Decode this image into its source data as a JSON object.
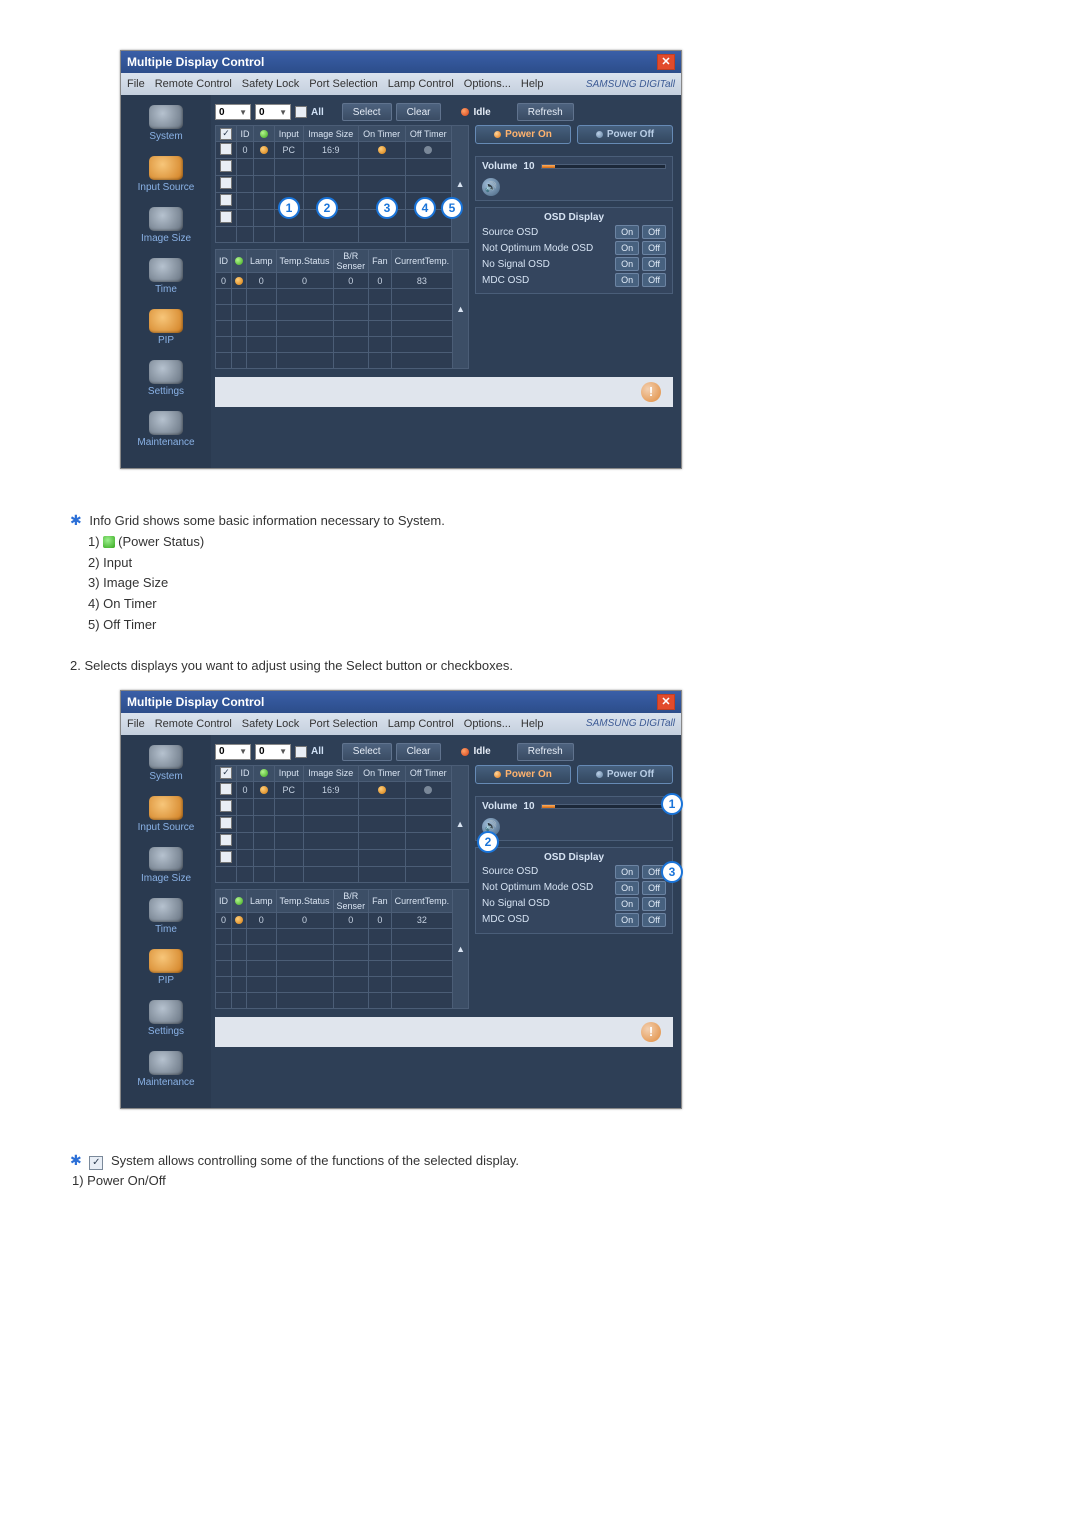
{
  "window": {
    "title": "Multiple Display Control",
    "brand": "SAMSUNG DIGITall"
  },
  "menu": [
    "File",
    "Remote Control",
    "Safety Lock",
    "Port Selection",
    "Lamp Control",
    "Options...",
    "Help"
  ],
  "sidebar": [
    {
      "label": "System"
    },
    {
      "label": "Input Source"
    },
    {
      "label": "Image Size"
    },
    {
      "label": "Time"
    },
    {
      "label": "PIP"
    },
    {
      "label": "Settings"
    },
    {
      "label": "Maintenance"
    }
  ],
  "toolbar": {
    "spin1": "0",
    "spin2": "0",
    "all": "All",
    "select": "Select",
    "clear": "Clear",
    "idle": "Idle",
    "refresh": "Refresh"
  },
  "grid1": {
    "headers": [
      "",
      "ID",
      "",
      "Input",
      "Image Size",
      "On Timer",
      "Off Timer"
    ],
    "row": {
      "id": "0",
      "input": "PC",
      "size": "16:9",
      "temp": "83"
    }
  },
  "grid2": {
    "headers": [
      "ID",
      "",
      "Lamp",
      "Temp.Status",
      "B/R Senser",
      "Fan",
      "CurrentTemp."
    ],
    "row": {
      "id": "0",
      "lamp": "0",
      "temp_status": "0",
      "br": "0",
      "fan": "0",
      "cur1": "83",
      "cur2": "32"
    }
  },
  "right": {
    "power_on": "Power On",
    "power_off": "Power Off",
    "volume_label": "Volume",
    "volume_value": "10",
    "osd_title": "OSD Display",
    "osd": [
      {
        "label": "Source OSD"
      },
      {
        "label": "Not Optimum Mode OSD"
      },
      {
        "label": "No Signal OSD"
      },
      {
        "label": "MDC OSD"
      }
    ],
    "on": "On",
    "off": "Off"
  },
  "doc1": {
    "intro": "Info Grid shows some basic information necessary to System.",
    "items": [
      "(Power Status)",
      "Input",
      "Image Size",
      "On Timer",
      "Off Timer"
    ],
    "step2": "2.  Selects displays you want to adjust using the Select button or checkboxes."
  },
  "doc2": {
    "intro": "System allows controlling some of the functions of the selected display.",
    "item1": "1)  Power On/Off"
  }
}
